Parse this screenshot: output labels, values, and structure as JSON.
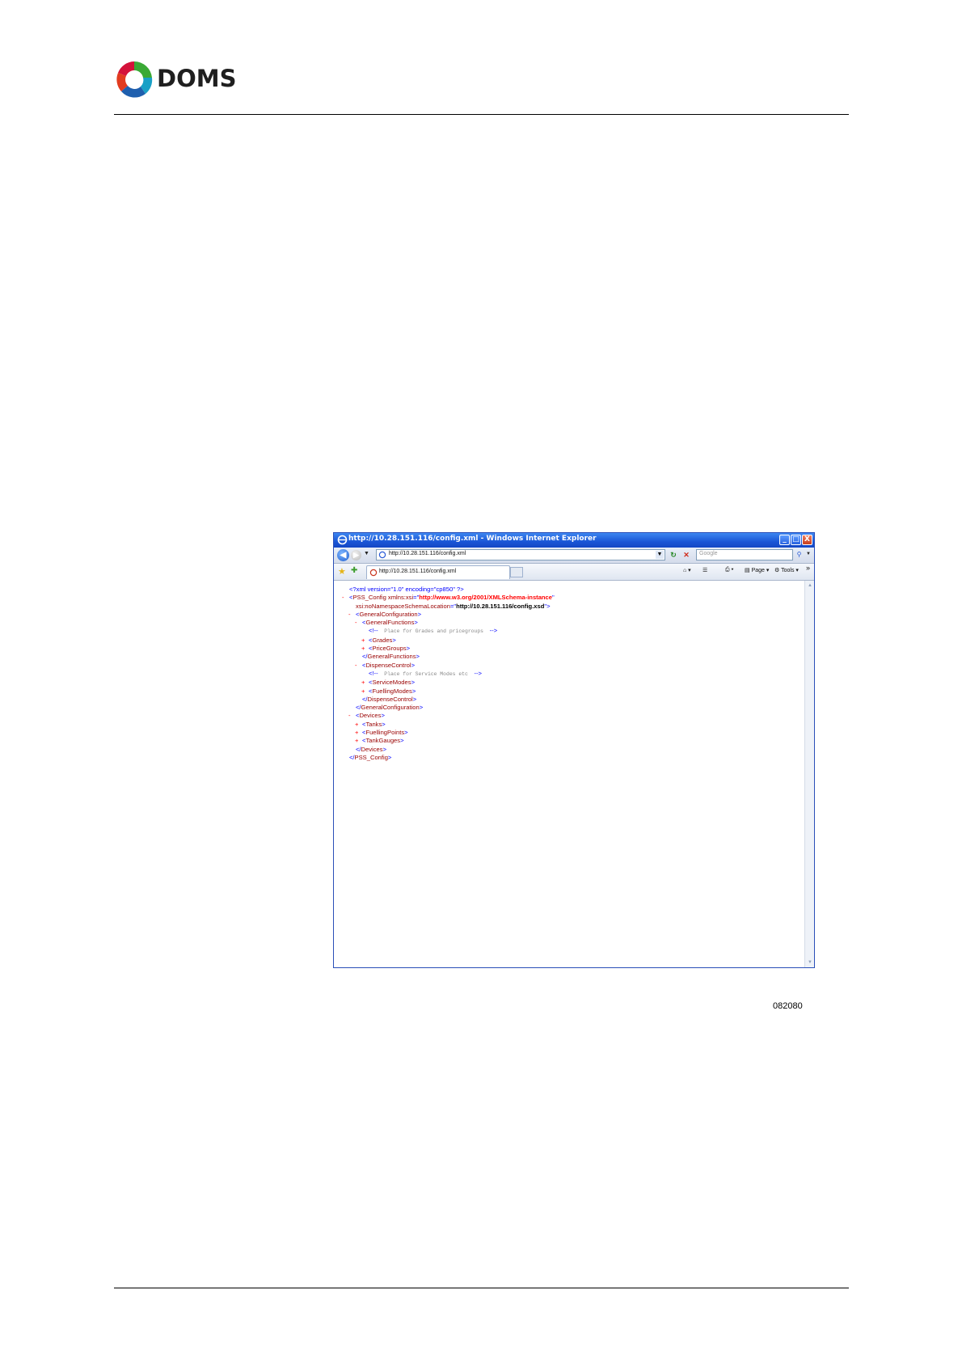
{
  "header": {
    "logo_text": "DOMS",
    "logo_tm": "™"
  },
  "browser": {
    "title": "http://10.28.151.116/config.xml - Windows Internet Explorer",
    "window_buttons": [
      "_",
      "□",
      "X"
    ],
    "address": "http://10.28.151.116/config.xml",
    "search_placeholder": "Google",
    "tab_title": "http://10.28.151.116/config.xml",
    "tools": {
      "page": "Page",
      "tools": "Tools",
      "more": "»"
    }
  },
  "xml_lines": [
    {
      "marker": "",
      "indent": 0,
      "parts": [
        {
          "c": "pi",
          "t": "<?xml version=\"1.0\" encoding=\"cp850\" ?>"
        }
      ]
    },
    {
      "marker": "-",
      "indent": 0,
      "parts": [
        {
          "c": "pu",
          "t": "<"
        },
        {
          "c": "t",
          "t": "PSS_Config"
        },
        {
          "c": "at",
          "t": " xmlns:xsi"
        },
        {
          "c": "pu",
          "t": "=\""
        },
        {
          "c": "av",
          "t": "http://www.w3.org/2001/XMLSchema-instance"
        },
        {
          "c": "pu",
          "t": "\""
        }
      ]
    },
    {
      "marker": "",
      "indent": 1,
      "parts": [
        {
          "c": "at",
          "t": "xsi:noNamespaceSchemaLocation"
        },
        {
          "c": "pu",
          "t": "=\""
        },
        {
          "c": "av2",
          "t": "http://10.28.151.116/config.xsd"
        },
        {
          "c": "pu",
          "t": "\">"
        }
      ]
    },
    {
      "marker": "-",
      "indent": 1,
      "parts": [
        {
          "c": "pu",
          "t": "<"
        },
        {
          "c": "t",
          "t": "GeneralConfiguration"
        },
        {
          "c": "pu",
          "t": ">"
        }
      ]
    },
    {
      "marker": "-",
      "indent": 2,
      "parts": [
        {
          "c": "pu",
          "t": "<"
        },
        {
          "c": "t",
          "t": "GeneralFunctions"
        },
        {
          "c": "pu",
          "t": ">"
        }
      ]
    },
    {
      "marker": "",
      "indent": 3,
      "parts": [
        {
          "c": "pu",
          "t": "<!--"
        },
        {
          "c": "cm",
          "t": "  Place for Grades and pricegroups  "
        },
        {
          "c": "pu",
          "t": "-->"
        }
      ]
    },
    {
      "marker": "+",
      "indent": 3,
      "parts": [
        {
          "c": "pu",
          "t": "<"
        },
        {
          "c": "t",
          "t": "Grades"
        },
        {
          "c": "pu",
          "t": ">"
        }
      ]
    },
    {
      "marker": "+",
      "indent": 3,
      "parts": [
        {
          "c": "pu",
          "t": "<"
        },
        {
          "c": "t",
          "t": "PriceGroups"
        },
        {
          "c": "pu",
          "t": ">"
        }
      ]
    },
    {
      "marker": "",
      "indent": 2,
      "parts": [
        {
          "c": "pu",
          "t": "</"
        },
        {
          "c": "t",
          "t": "GeneralFunctions"
        },
        {
          "c": "pu",
          "t": ">"
        }
      ]
    },
    {
      "marker": "-",
      "indent": 2,
      "parts": [
        {
          "c": "pu",
          "t": "<"
        },
        {
          "c": "t",
          "t": "DispenseControl"
        },
        {
          "c": "pu",
          "t": ">"
        }
      ]
    },
    {
      "marker": "",
      "indent": 3,
      "parts": [
        {
          "c": "pu",
          "t": "<!--"
        },
        {
          "c": "cm",
          "t": "  Place for Service Modes etc  "
        },
        {
          "c": "pu",
          "t": "-->"
        }
      ]
    },
    {
      "marker": "+",
      "indent": 3,
      "parts": [
        {
          "c": "pu",
          "t": "<"
        },
        {
          "c": "t",
          "t": "ServiceModes"
        },
        {
          "c": "pu",
          "t": ">"
        }
      ]
    },
    {
      "marker": "+",
      "indent": 3,
      "parts": [
        {
          "c": "pu",
          "t": "<"
        },
        {
          "c": "t",
          "t": "FuellingModes"
        },
        {
          "c": "pu",
          "t": ">"
        }
      ]
    },
    {
      "marker": "",
      "indent": 2,
      "parts": [
        {
          "c": "pu",
          "t": "</"
        },
        {
          "c": "t",
          "t": "DispenseControl"
        },
        {
          "c": "pu",
          "t": ">"
        }
      ]
    },
    {
      "marker": "",
      "indent": 1,
      "parts": [
        {
          "c": "pu",
          "t": "</"
        },
        {
          "c": "t",
          "t": "GeneralConfiguration"
        },
        {
          "c": "pu",
          "t": ">"
        }
      ]
    },
    {
      "marker": "-",
      "indent": 1,
      "parts": [
        {
          "c": "pu",
          "t": "<"
        },
        {
          "c": "t",
          "t": "Devices"
        },
        {
          "c": "pu",
          "t": ">"
        }
      ]
    },
    {
      "marker": "+",
      "indent": 2,
      "parts": [
        {
          "c": "pu",
          "t": "<"
        },
        {
          "c": "t",
          "t": "Tanks"
        },
        {
          "c": "pu",
          "t": ">"
        }
      ]
    },
    {
      "marker": "+",
      "indent": 2,
      "parts": [
        {
          "c": "pu",
          "t": "<"
        },
        {
          "c": "t",
          "t": "FuellingPoints"
        },
        {
          "c": "pu",
          "t": ">"
        }
      ]
    },
    {
      "marker": "+",
      "indent": 2,
      "parts": [
        {
          "c": "pu",
          "t": "<"
        },
        {
          "c": "t",
          "t": "TankGauges"
        },
        {
          "c": "pu",
          "t": ">"
        }
      ]
    },
    {
      "marker": "",
      "indent": 1,
      "parts": [
        {
          "c": "pu",
          "t": "</"
        },
        {
          "c": "t",
          "t": "Devices"
        },
        {
          "c": "pu",
          "t": ">"
        }
      ]
    },
    {
      "marker": "",
      "indent": 0,
      "parts": [
        {
          "c": "pu",
          "t": "</"
        },
        {
          "c": "t",
          "t": "PSS_Config"
        },
        {
          "c": "pu",
          "t": ">"
        }
      ]
    }
  ],
  "figure_id": "082080",
  "colors": {
    "titlebar": "#1a56d6",
    "tag": "#990000",
    "punct": "#0000ff",
    "attr_value": "#ff0000"
  }
}
